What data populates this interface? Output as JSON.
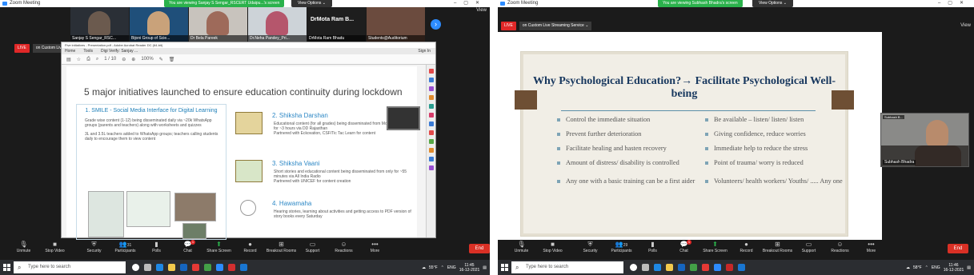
{
  "left": {
    "app_title": "Zoom Meeting",
    "share_banner": "You are viewing Sanjay S Sengar_RSCERT Udaipu...'s screen",
    "view_options": "View Options ⌄",
    "view_link": "View",
    "live_badge": "LIVE",
    "live_text": "on Custom Live Streaming Service ⌄",
    "participants": [
      {
        "name": "Sanjay S Sengar_RSC...",
        "big": ""
      },
      {
        "name": "Bijoni Group of Scie...",
        "big": ""
      },
      {
        "name": "Dr Bela Pareek",
        "big": ""
      },
      {
        "name": "Dr.Neha Pandey_Pri...",
        "big": ""
      },
      {
        "name": "DrMota Ram Bhadu",
        "big": "DrMota Ram B..."
      },
      {
        "name": "Students@Auditorium",
        "big": ""
      }
    ],
    "acrobat": {
      "title": "Five initiatives - Presentation.pdf - Adobe Acrobat Reader DC (64-bit)",
      "menu": [
        "Home",
        "Tools",
        "Digi Verify: Sanjay ..."
      ],
      "sign_in": "Sign In",
      "page_indicator": "1 / 10",
      "zoom": "100%",
      "slide_title": "5 major initiatives launched to ensure education continuity during lockdown",
      "smile_title": "1. SMILE - Social Media Interface for Digital Learning",
      "smile_points": [
        "Grade wise content (1-12) being disseminated daily via ~20k WhatsApp groups (parents and teachers) along with worksheets and quizzes",
        "3L and 3.5L teachers added to WhatsApp groups; teachers calling students daily to encourage them to view content"
      ],
      "items": [
        {
          "title": "2. Shiksha Darshan",
          "points": [
            "Educational content (for all grades) being disseminated from Monday to Saturday for ~3 hours via DD Rajasthan",
            "Partnered with Eckovation, CSF/Tic Tac Learn for content"
          ]
        },
        {
          "title": "3. Shiksha Vaani",
          "points": [
            "Short stories and educational content being disseminated from only for ~55 minutes via All India Radio",
            "Partnered with UNICEF for content creation"
          ]
        },
        {
          "title": "4. Hawamaha",
          "points": [
            "Hearing stories, learning about activities and getting access to PDF version of story books every Saturday"
          ]
        }
      ]
    },
    "controls": [
      "Unmute",
      "Stop Video",
      "Security",
      "Participants",
      "Polls",
      "Chat",
      "Share Screen",
      "Record",
      "Breakout Rooms",
      "Support",
      "Reactions",
      "More"
    ],
    "participants_count": "31",
    "chat_badge": "1",
    "end_label": "End",
    "taskbar": {
      "search_placeholder": "Type here to search",
      "weather": "55°F",
      "lang": "ENG",
      "time": "11:45",
      "date": "16-12-2021"
    }
  },
  "right": {
    "app_title": "Zoom Meeting",
    "share_banner": "You are viewing Subhash Bhadra's screen",
    "view_options": "View Options ⌄",
    "view_link": "View",
    "live_badge": "LIVE",
    "live_text": "on Custom Live Streaming Service ⌄",
    "slide_title": "Why Psychological Education?→ Facilitate Psychological Well-being",
    "left_points": [
      "Control the immediate situation",
      "Prevent further deterioration",
      "Facilitate healing and hasten recovery",
      "Amount of distress/ disability is controlled",
      "Any one with a basic training can be a first aider"
    ],
    "right_points": [
      "Be available – listen/ listen/ listen",
      "Giving confidence, reduce worries",
      "Immediate help to reduce the stress",
      "Point of trauma/ worry is reduced",
      "Volunteers/ health workers/ Youths/ ..... Any one"
    ],
    "video_name": "Subhash Bhadra",
    "video_mute": "Subhash B...",
    "controls": [
      "Unmute",
      "Stop Video",
      "Security",
      "Participants",
      "Polls",
      "Chat",
      "Share Screen",
      "Record",
      "Breakout Rooms",
      "Support",
      "Reactions",
      "More"
    ],
    "participants_count": "29",
    "chat_badge": "1",
    "end_label": "End",
    "taskbar": {
      "search_placeholder": "Type here to search",
      "weather": "58°F",
      "lang": "ENG",
      "time": "11:46",
      "date": "16-12-2021"
    }
  },
  "colors": {
    "zoom_blue": "#2d8cff",
    "share_green": "#2bb24c",
    "live_red": "#e02828",
    "slide_title": "#17375e"
  }
}
